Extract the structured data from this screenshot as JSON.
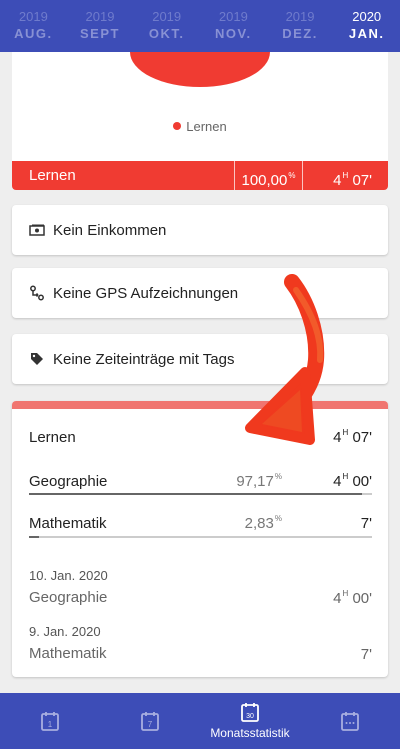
{
  "months": [
    {
      "year": "2019",
      "month": "AUG."
    },
    {
      "year": "2019",
      "month": "SEPT"
    },
    {
      "year": "2019",
      "month": "OKT."
    },
    {
      "year": "2019",
      "month": "NOV."
    },
    {
      "year": "2019",
      "month": "DEZ."
    },
    {
      "year": "2020",
      "month": "JAN."
    }
  ],
  "pie": {
    "legend_label": "Lernen",
    "color": "#f03b32"
  },
  "summary_row": {
    "name": "Lernen",
    "percent": "100,00",
    "percent_sup": "%",
    "hours": "4",
    "hours_sup": "H",
    "minutes": "07'"
  },
  "info_cards": {
    "income": "Kein Einkommen",
    "gps": "Keine GPS Aufzeichnungen",
    "tags": "Keine Zeiteinträge mit Tags"
  },
  "detail": {
    "header": {
      "name": "Lernen",
      "hours": "4",
      "hours_sup": "H",
      "minutes": "07'"
    },
    "subjects": [
      {
        "name": "Geographie",
        "percent": "97,17",
        "percent_sup": "%",
        "hours": "4",
        "hours_sup": "H",
        "minutes": "00'",
        "share": 0.9717
      },
      {
        "name": "Mathematik",
        "percent": "2,83",
        "percent_sup": "%",
        "hours": "",
        "hours_sup": "",
        "minutes": "7'",
        "share": 0.0283
      }
    ],
    "entries": [
      {
        "date": "10. Jan. 2020",
        "name": "Geographie",
        "hours": "4",
        "hours_sup": "H",
        "minutes": "00'"
      },
      {
        "date": "9. Jan. 2020",
        "name": "Mathematik",
        "hours": "",
        "hours_sup": "",
        "minutes": "7'"
      }
    ]
  },
  "bottom_nav": {
    "day_icon_num": "1",
    "week_icon_num": "7",
    "month_icon_num": "30",
    "month_label": "Monatsstatistik"
  },
  "colors": {
    "primary": "#3d4db7",
    "accent_red": "#f03b32",
    "strip": "#f07570"
  }
}
